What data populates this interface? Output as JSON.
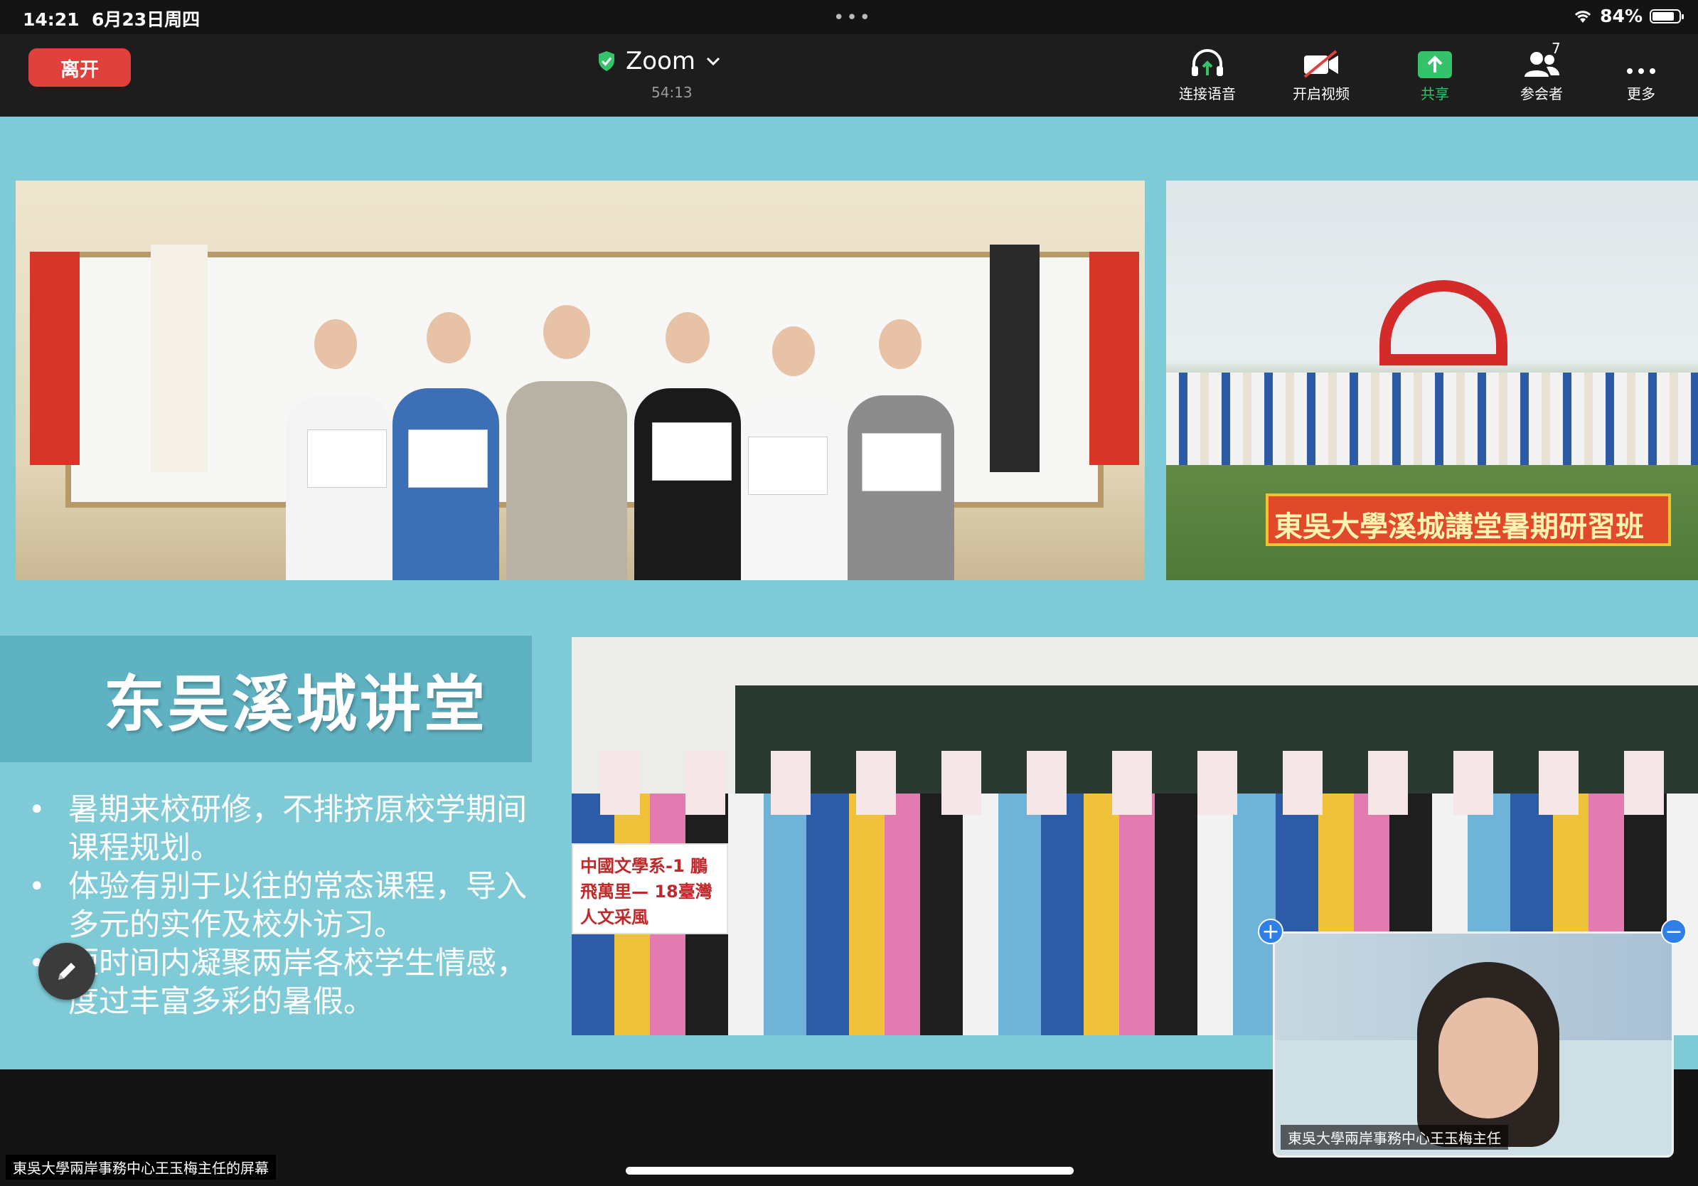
{
  "status_bar": {
    "time": "14:21",
    "date": "6月23日周四",
    "battery": "84%",
    "battery_level": 0.84
  },
  "toolbar": {
    "leave_label": "离开",
    "meeting_title": "Zoom",
    "meeting_timer": "54:13",
    "items": [
      {
        "label": "连接语音",
        "icon": "headphone-icon"
      },
      {
        "label": "开启视频",
        "icon": "video-off-icon"
      },
      {
        "label": "共享",
        "icon": "share-up-icon"
      },
      {
        "label": "参会者",
        "icon": "participants-icon",
        "count": "7"
      },
      {
        "label": "更多",
        "icon": "more-dots-icon"
      }
    ],
    "accent_color": "#36c26a",
    "leave_color": "#e0413c"
  },
  "shared_screen": {
    "background_color": "#7ecad6",
    "slide": {
      "title": "东吴溪城讲堂",
      "bullets": [
        "暑期来校研修，不排挤原校学期间课程规划。",
        "体验有别于以往的常态课程，导入多元的实作及校外访习。",
        "短时间内凝聚两岸各校学生情感，度过丰富多彩的暑假。"
      ],
      "photo_banner_text": "東吳大學溪城講堂暑期研習班",
      "photo_sign_text": "中國文學系-1 鵬飛萬里— 18臺灣人文采風"
    }
  },
  "video_tile": {
    "name": "東吳大學兩岸事務中心王玉梅主任"
  },
  "screen_owner_label": "東吳大學兩岸事務中心王玉梅主任的屏幕"
}
